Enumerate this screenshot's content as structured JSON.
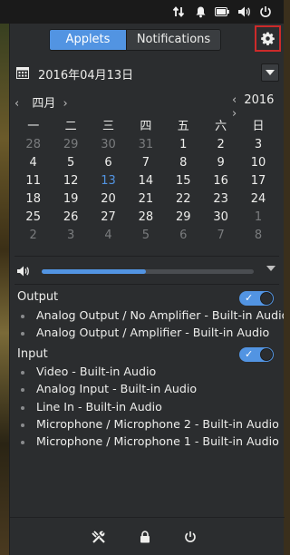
{
  "topbar": {
    "icons": [
      "network-arrows-icon",
      "notification-bell-icon",
      "battery-icon",
      "volume-icon",
      "power-icon"
    ]
  },
  "tabs": [
    {
      "label": "Applets",
      "active": true
    },
    {
      "label": "Notifications",
      "active": false
    }
  ],
  "date": {
    "text": "2016年04月13日"
  },
  "calendar": {
    "month_label": "四月",
    "year_label": "2016",
    "weekdays": [
      "一",
      "二",
      "三",
      "四",
      "五",
      "六",
      "日"
    ],
    "weeks": [
      [
        "28",
        "29",
        "30",
        "31",
        "1",
        "2",
        "3"
      ],
      [
        "4",
        "5",
        "6",
        "7",
        "8",
        "9",
        "10"
      ],
      [
        "11",
        "12",
        "13",
        "14",
        "15",
        "16",
        "17"
      ],
      [
        "18",
        "19",
        "20",
        "21",
        "22",
        "23",
        "24"
      ],
      [
        "25",
        "26",
        "27",
        "28",
        "29",
        "30",
        "1"
      ],
      [
        "2",
        "3",
        "4",
        "5",
        "6",
        "7",
        "8"
      ]
    ],
    "today": "13"
  },
  "volume": {
    "level_fraction": 0.49
  },
  "output": {
    "label": "Output",
    "enabled": true,
    "devices": [
      "Analog Output / No Amplifier - Built-in Audio",
      "Analog Output / Amplifier - Built-in Audio"
    ]
  },
  "input": {
    "label": "Input",
    "enabled": true,
    "devices": [
      "Video - Built-in Audio",
      "Analog Input - Built-in Audio",
      "Line In - Built-in Audio",
      "Microphone / Microphone 2 - Built-in Audio",
      "Microphone / Microphone 1 - Built-in Audio"
    ]
  },
  "colors": {
    "accent": "#5294e2",
    "highlight_border": "#cc2a2a"
  }
}
